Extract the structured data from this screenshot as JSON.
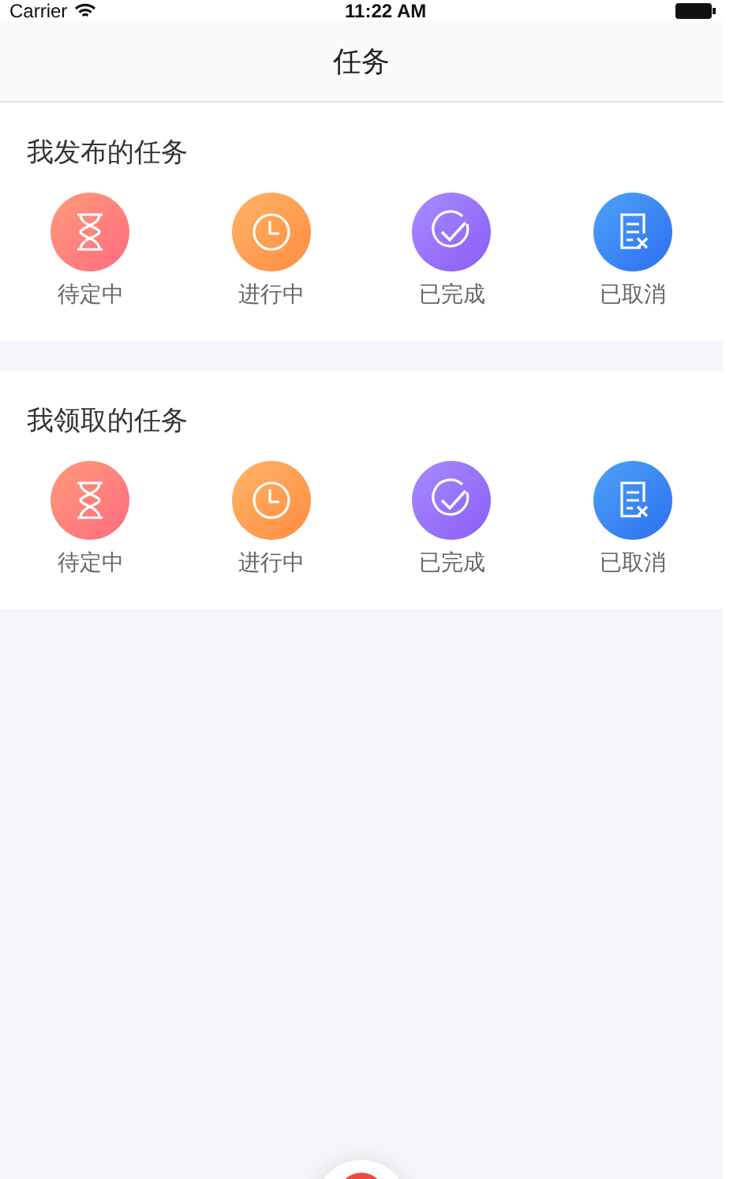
{
  "status_bar": {
    "carrier": "Carrier",
    "time": "11:22 AM"
  },
  "nav": {
    "title": "任务"
  },
  "sections": [
    {
      "title": "我发布的任务",
      "items": [
        {
          "kind": "pending",
          "label": "待定中"
        },
        {
          "kind": "ongoing",
          "label": "进行中"
        },
        {
          "kind": "done",
          "label": "已完成"
        },
        {
          "kind": "cancelled",
          "label": "已取消"
        }
      ]
    },
    {
      "title": "我领取的任务",
      "items": [
        {
          "kind": "pending",
          "label": "待定中"
        },
        {
          "kind": "ongoing",
          "label": "进行中"
        },
        {
          "kind": "done",
          "label": "已完成"
        },
        {
          "kind": "cancelled",
          "label": "已取消"
        }
      ]
    }
  ]
}
